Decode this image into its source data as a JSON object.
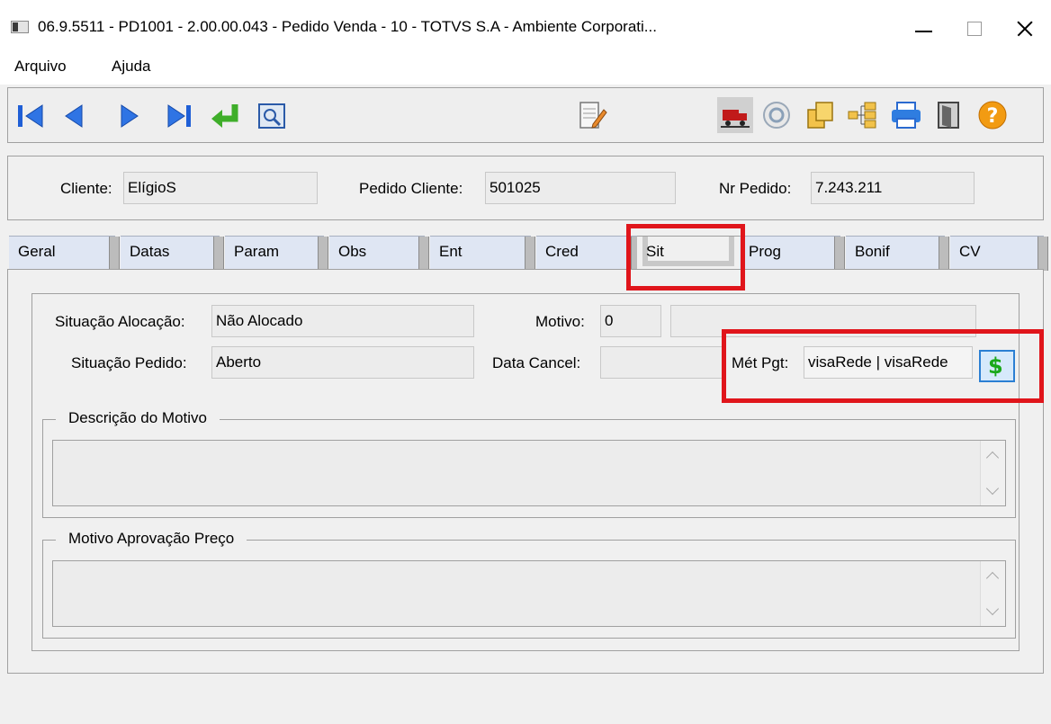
{
  "window": {
    "title": "06.9.5511 - PD1001 - 2.00.00.043 - Pedido Venda - 10 - TOTVS S.A - Ambiente Corporati..."
  },
  "menu": {
    "items": [
      "Arquivo",
      "Ajuda"
    ]
  },
  "toolbar": {
    "buttons": [
      {
        "icon": "first-record-icon"
      },
      {
        "icon": "previous-record-icon"
      },
      {
        "icon": "next-record-icon"
      },
      {
        "icon": "last-record-icon"
      },
      {
        "icon": "goto-icon"
      },
      {
        "icon": "search-icon"
      },
      {
        "icon": "notepad-icon"
      },
      {
        "icon": "truck-icon"
      },
      {
        "icon": "zoom-icon"
      },
      {
        "icon": "copy-icon"
      },
      {
        "icon": "tree-icon"
      },
      {
        "icon": "print-icon"
      },
      {
        "icon": "exit-icon"
      },
      {
        "icon": "help-icon"
      }
    ]
  },
  "header": {
    "cliente_label": "Cliente:",
    "cliente_value": "ElígioS",
    "pedido_cliente_label": "Pedido Cliente:",
    "pedido_cliente_value": "501025",
    "nr_pedido_label": "Nr Pedido:",
    "nr_pedido_value": "7.243.211"
  },
  "tabs": [
    "Geral",
    "Datas",
    "Param",
    "Obs",
    "Ent",
    "Cred",
    "Sit",
    "Prog",
    "Bonif",
    "CV"
  ],
  "active_tab": "Sit",
  "sit": {
    "situacao_alocacao_label": "Situação Alocação:",
    "situacao_alocacao_value": "Não Alocado",
    "situacao_pedido_label": "Situação Pedido:",
    "situacao_pedido_value": "Aberto",
    "motivo_label": "Motivo:",
    "motivo_value": "0",
    "motivo_desc_value": "",
    "data_cancel_label": "Data Cancel:",
    "data_cancel_value": "",
    "met_pgt_label": "Mét Pgt:",
    "met_pgt_value": "visaRede | visaRede",
    "payment_button_symbol": "$",
    "descricao_motivo_title": "Descrição do Motivo",
    "motivo_aprovacao_title": "Motivo Aprovação Preço"
  },
  "colors": {
    "highlight": "#e0151b",
    "tab_background": "#dfe6f3",
    "accent_blue": "#2b7fd3"
  }
}
